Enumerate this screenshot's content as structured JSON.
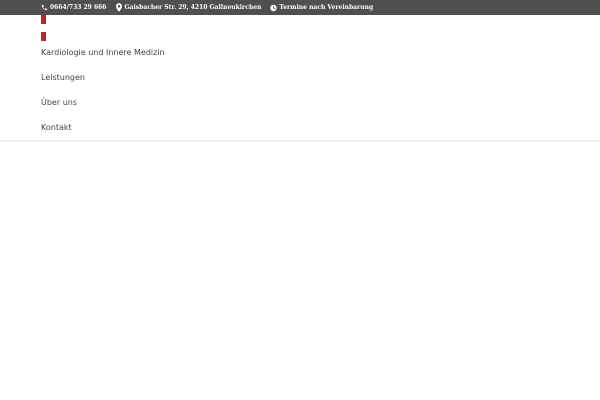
{
  "topbar": {
    "phone": {
      "icon": "phone-icon",
      "text": "0664/733 29 666"
    },
    "address": {
      "icon": "map-pin-icon",
      "text": "Gaisbacher Str. 29, 4210 Gallneukirchen"
    },
    "hours": {
      "icon": "clock-icon",
      "text": "Termine nach Vereinbarung"
    },
    "background": "#4f4f4f",
    "text_color": "#ffffff"
  },
  "logo": {
    "color": "#b12b2f"
  },
  "nav": {
    "items": [
      {
        "label": "Kardiologie und Innere Medizin"
      },
      {
        "label": "Leistungen"
      },
      {
        "label": "Über uns"
      },
      {
        "label": "Kontakt"
      }
    ],
    "text_color": "#444444"
  }
}
